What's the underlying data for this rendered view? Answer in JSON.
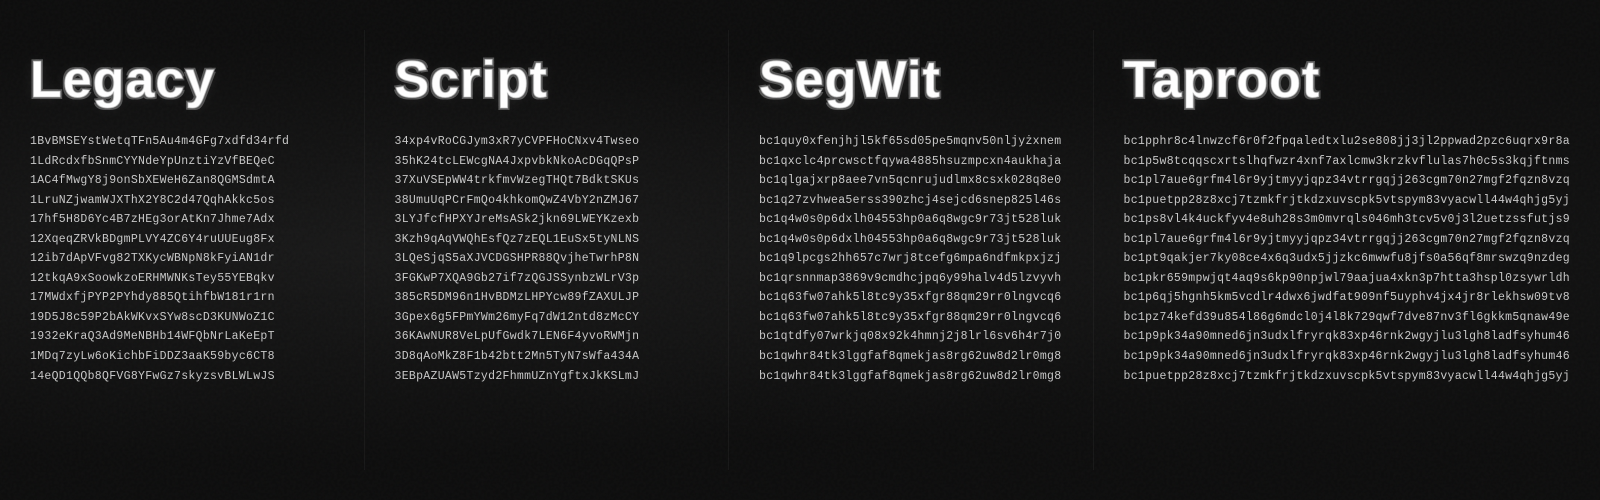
{
  "columns": [
    {
      "id": "legacy",
      "title": "Legacy",
      "addresses": [
        "1BvBMSEYstWetqTFn5Au4m4GFg7xdfd34rfd",
        "1LdRcdxfbSnmCYYNdeYpUnztiYzVfBEQeC",
        "1AC4fMwgY8j9onSbXEWeH6Zan8QGMSdmtA",
        "1LruNZjwamWJXThX2Y8C2d47QqhAkkc5os",
        "17hf5H8D6Yc4B7zHEg3orAtKn7Jhme7Adx",
        "12XqeqZRVkBDgmPLVY4ZC6Y4ruUUEug8Fx",
        "12ib7dApVFvg82TXKycWBNpN8kFyiAN1dr",
        "12tkqA9xSoowkzoERHMWNKsTey55YEBqkv",
        "17MWdxfjPYP2PYhdy885QtihfbW181r1rn",
        "19D5J8c59P2bAkWKvxSYw8scD3KUNWoZ1C",
        "1932eKraQ3Ad9MeNBHb14WFQbNrLaKeEpT",
        "1MDq7zyLw6oKichbFiDDZ3aaK59byc6CT8",
        "14eQD1QQb8QFVG8YFwGz7skyzsvBLWLwJS"
      ]
    },
    {
      "id": "script",
      "title": "Script",
      "addresses": [
        "34xp4vRoCGJym3xR7yCVPFHoCNxv4Twseo",
        "35hK24tcLEWcgNA4JxpvbkNkoAcDGqQPsP",
        "37XuVSEpWW4trkfmvWzegTHQt7BdktSKUs",
        "38UmuUqPCrFmQo4khkomQwZ4VbY2nZMJ67",
        "3LYJfcfHPXYJreMsASk2jkn69LWEYKzexb",
        "3Kzh9qAqVWQhEsfQz7zEQL1EuSx5tyNLNS",
        "3LQeSjqS5aXJVCDGSHPR88QvjheTwrhP8N",
        "3FGKwP7XQA9Gb27if7zQGJSSynbzWLrV3p",
        "385cR5DM96n1HvBDMzLHPYcw89fZAXULJP",
        "3Gpex6g5FPmYWm26myFq7dW12ntd8zMcCY",
        "36KAwNUR8VeLpUfGwdk7LEN6F4yvoRWMjn",
        "3D8qAoMkZ8F1b42btt2Mn5TyN7sWfa434A",
        "3EBpAZUAW5Tzyd2FhmmUZnYgftxJkKSLmJ"
      ]
    },
    {
      "id": "segwit",
      "title": "SegWit",
      "addresses": [
        "bc1quy0xfenjhjl5kf65sd05pe5mqnv50nljyżxnem",
        "bc1qxclc4prcwsctfqywa4885hsuzmpcxn4aukhaja",
        "bc1qlgajxrp8aee7vn5qcnrujudlmx8csxk028q8e0",
        "bc1q27zvhwea5erss390zhcj4sejcd6snep825l46s",
        "bc1q4w0s0p6dxlh04553hp0a6q8wgc9r73jt528luk",
        "bc1q4w0s0p6dxlh04553hp0a6q8wgc9r73jt528luk",
        "bc1q9lpcgs2hh657c7wrj8tcefg6mpa6ndfmkpxjzj",
        "bc1qrsnnmap3869v9cmdhcjpq6y99halv4d5lzvyvh",
        "bc1q63fw07ahk5l8tc9y35xfgr88qm29rr0lngvcq6",
        "bc1q63fw07ahk5l8tc9y35xfgr88qm29rr0lngvcq6",
        "bc1qtdfy07wrkjq08x92k4hmnj2j8lrl6sv6h4r7j0",
        "bc1qwhr84tk3lggfaf8qmekjas8rg62uw8d2lr0mg8",
        "bc1qwhr84tk3lggfaf8qmekjas8rg62uw8d2lr0mg8"
      ]
    },
    {
      "id": "taproot",
      "title": "Taproot",
      "addresses": [
        "bc1pphr8c4lnwzcf6r0f2fpqaledtxlu2se808jj3jl2ppwad2pzc6uqrx9r8a",
        "bc1p5w8tcqqscxrtslhqfwzr4xnf7axlcmw3krzkvflulas7h0c5s3kqjftnms",
        "bc1pl7aue6grfm4l6r9yjtmyyjqpz34vtrrgqjj263cgm70n27mgf2fqzn8vzq",
        "bc1puetpp28z8xcj7tzmkfrjtkdzxuvscpk5vtspym83vyacwll44w4qhjg5yj",
        "bc1ps8vl4k4uckfyv4e8uh28s3m0mvrqls046mh3tcv5v0j3l2uetzssfutjs9",
        "bc1pl7aue6grfm4l6r9yjtmyyjqpz34vtrrgqjj263cgm70n27mgf2fqzn8vzq",
        "bc1pt9qakjer7ky08ce4x6q3udx5jjzkc6mwwfu8jfs0a56qf8mrswzq9nzdeg",
        "bc1pkr659mpwjqt4aq9s6kp90npjwl79aajua4xkn3p7htta3hspl0zsywrldh",
        "bc1p6qj5hgnh5km5vcdlr4dwx6jwdfat909nf5uyphv4jx4jr8rlekhsw09tv8",
        "bc1pz74kefd39u854l86g6mdcl0j4l8k729qwf7dve87nv3fl6gkkm5qnaw49e",
        "bc1p9pk34a90mned6jn3udxlfryrqk83xp46rnk2wgyjlu3lgh8ladfsyhum46",
        "bc1p9pk34a90mned6jn3udxlfryrqk83xp46rnk2wgyjlu3lgh8ladfsyhum46",
        "bc1puetpp28z8xcj7tzmkfrjtkdzxuvscpk5vtspym83vyacwll44w4qhjg5yj"
      ]
    }
  ]
}
